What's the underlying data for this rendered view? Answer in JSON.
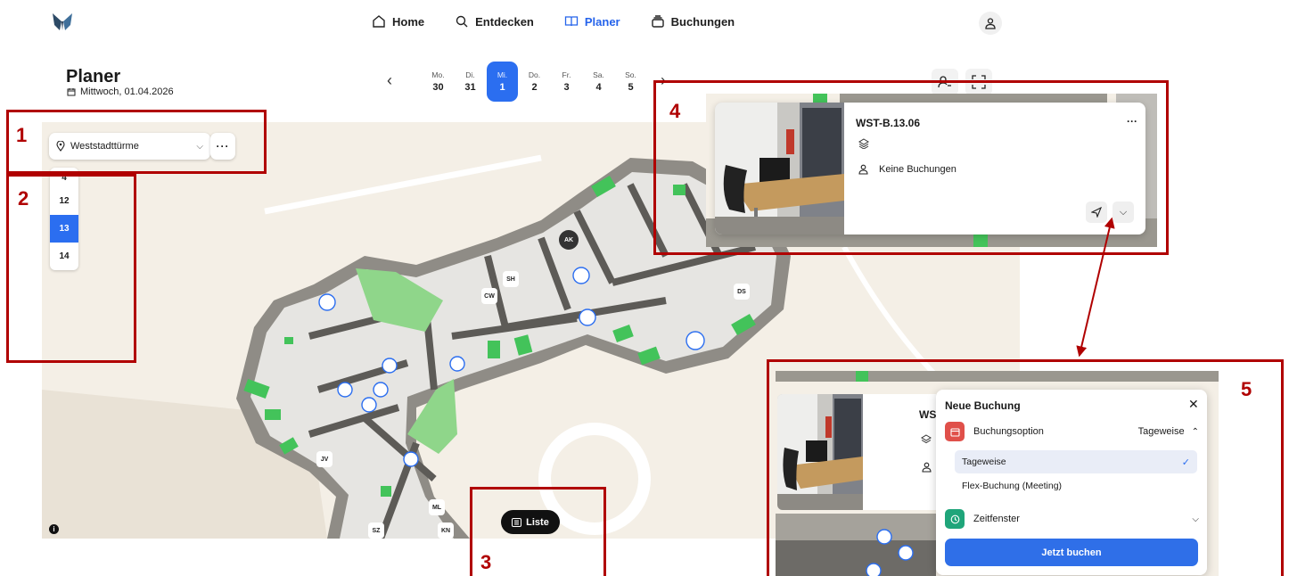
{
  "nav": {
    "items": [
      {
        "label": "Home",
        "icon": "home-icon"
      },
      {
        "label": "Entdecken",
        "icon": "search-icon"
      },
      {
        "label": "Planer",
        "icon": "book-icon",
        "active": true
      },
      {
        "label": "Buchungen",
        "icon": "stack-icon"
      }
    ]
  },
  "header": {
    "title": "Planer",
    "subtitle": "Mittwoch, 01.04.2026"
  },
  "dates": [
    {
      "day": "Mo.",
      "date": "30"
    },
    {
      "day": "Di.",
      "date": "31"
    },
    {
      "day": "Mi.",
      "date": "1",
      "active": true
    },
    {
      "day": "Do.",
      "date": "2"
    },
    {
      "day": "Fr.",
      "date": "3"
    },
    {
      "day": "Sa.",
      "date": "4"
    },
    {
      "day": "So.",
      "date": "5"
    }
  ],
  "location": {
    "value": "Weststadttürme"
  },
  "floors": [
    "4",
    "12",
    "13",
    "14"
  ],
  "active_floor": "13",
  "list_button": "Liste",
  "map_labels": [
    "AK",
    "SH",
    "CW",
    "DS",
    "JV",
    "ML",
    "SZ",
    "KN"
  ],
  "workplace": {
    "title": "WST-B.13.06",
    "title_cut": "WS",
    "bookings": "Keine Buchungen"
  },
  "booking": {
    "title": "Neue Buchung",
    "option_label": "Buchungsoption",
    "option_value": "Tageweise",
    "options": [
      "Tageweise",
      "Flex-Buchung (Meeting)"
    ],
    "time_label": "Zeitfenster",
    "submit": "Jetzt buchen"
  },
  "annotations": [
    "1",
    "2",
    "3",
    "4",
    "5"
  ],
  "colors": {
    "accent": "#2b6ef0",
    "annotation": "#b00000",
    "desk_green": "#43c35a",
    "calendar_red": "#e0504a",
    "clock_green": "#1fa57a"
  }
}
